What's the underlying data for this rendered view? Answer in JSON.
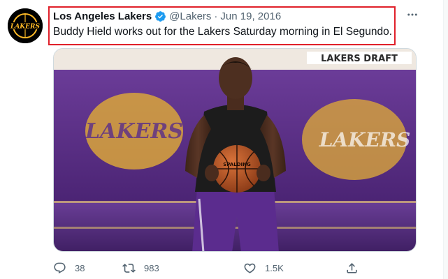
{
  "tweet": {
    "author_name": "Los Angeles Lakers",
    "handle": "@Lakers",
    "separator": "·",
    "date": "Jun 19, 2016",
    "text": "Buddy Hield works out for the Lakers Saturday morning in El Segundo.",
    "verified": true
  },
  "media": {
    "jersey_text": "LAKERS",
    "banner_text": "LAKERS DRAFT",
    "ball_text": "SPALDING"
  },
  "actions": {
    "reply_count": "38",
    "retweet_count": "983",
    "like_count": "1.5K"
  },
  "icons": {
    "more": "more-options-icon",
    "reply": "reply-icon",
    "retweet": "retweet-icon",
    "like": "heart-icon",
    "share": "share-icon",
    "verified": "verified-badge-icon"
  },
  "colors": {
    "highlight_border": "#e0202a",
    "verified": "#1d9bf0",
    "lakers_purple": "#552583",
    "lakers_gold": "#fdb927",
    "secondary_text": "#536471"
  }
}
